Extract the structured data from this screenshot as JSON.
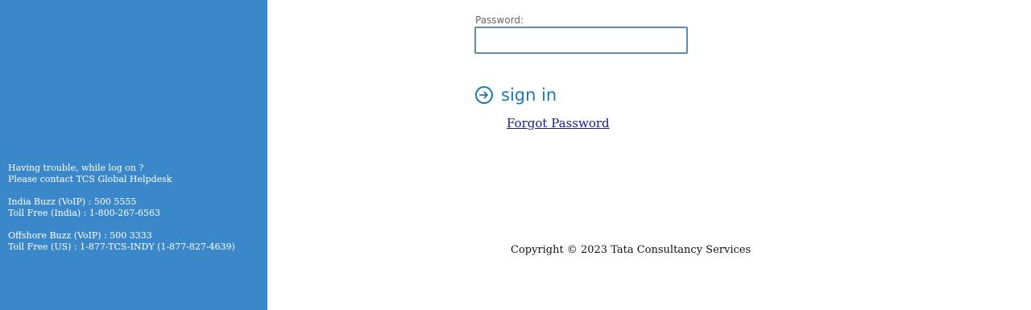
{
  "login": {
    "password_label": "Password:",
    "password_value": "",
    "signin_label": "sign in",
    "signin_icon": "arrow-right-circle-icon",
    "forgot_password": "Forgot Password"
  },
  "help": {
    "line1": "Having trouble, while log on ?",
    "line2": "Please contact TCS Global Helpdesk",
    "india_buzz": "India Buzz (VoIP) : 500 5555",
    "india_toll_free": "Toll Free (India) : 1-800-267-6563",
    "offshore_buzz": "Offshore Buzz (VoIP) : 500 3333",
    "us_toll_free": "Toll Free (US) : 1-877-TCS-INDY (1-877-827-4639)"
  },
  "footer": {
    "copyright": "Copyright © 2023 Tata Consultancy Services"
  },
  "colors": {
    "sidebar": "#3a88c9",
    "accent": "#1b78b8",
    "link": "#1a1a8c"
  }
}
